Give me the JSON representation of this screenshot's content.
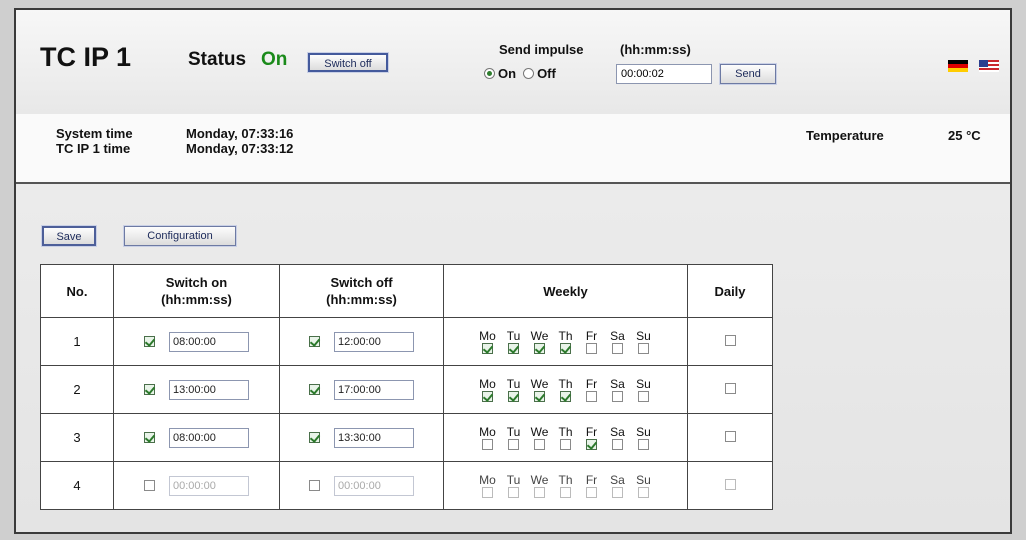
{
  "header": {
    "title": "TC IP 1",
    "status_label": "Status",
    "status_value": "On",
    "switch_off_label": "Switch off",
    "impulse_label": "Send impulse",
    "impulse_on_label": "On",
    "impulse_off_label": "Off",
    "impulse_selected": "On",
    "format_label": "(hh:mm:ss)",
    "impulse_value": "00:00:02",
    "send_label": "Send",
    "languages": [
      "de",
      "en"
    ]
  },
  "timebar": {
    "system_time_label": "System time",
    "system_time_value": "Monday, 07:33:16",
    "device_time_label": "TC IP 1 time",
    "device_time_value": "Monday, 07:33:12",
    "temperature_label": "Temperature",
    "temperature_value": "25 °C"
  },
  "toolbar": {
    "save_label": "Save",
    "config_label": "Configuration"
  },
  "table": {
    "headers": {
      "no": "No.",
      "switch_on": "Switch on",
      "switch_on_fmt": "(hh:mm:ss)",
      "switch_off": "Switch off",
      "switch_off_fmt": "(hh:mm:ss)",
      "weekly": "Weekly",
      "daily": "Daily"
    },
    "day_labels": [
      "Mo",
      "Tu",
      "We",
      "Th",
      "Fr",
      "Sa",
      "Su"
    ],
    "rows": [
      {
        "no": "1",
        "on_enabled": true,
        "on_time": "08:00:00",
        "off_enabled": true,
        "off_time": "12:00:00",
        "days": [
          true,
          true,
          true,
          true,
          false,
          false,
          false
        ],
        "daily": false,
        "disabled": false
      },
      {
        "no": "2",
        "on_enabled": true,
        "on_time": "13:00:00",
        "off_enabled": true,
        "off_time": "17:00:00",
        "days": [
          true,
          true,
          true,
          true,
          false,
          false,
          false
        ],
        "daily": false,
        "disabled": false
      },
      {
        "no": "3",
        "on_enabled": true,
        "on_time": "08:00:00",
        "off_enabled": true,
        "off_time": "13:30:00",
        "days": [
          false,
          false,
          false,
          false,
          true,
          false,
          false
        ],
        "daily": false,
        "disabled": false
      },
      {
        "no": "4",
        "on_enabled": false,
        "on_time": "00:00:00",
        "off_enabled": false,
        "off_time": "00:00:00",
        "days": [
          false,
          false,
          false,
          false,
          false,
          false,
          false
        ],
        "daily": false,
        "disabled": true
      }
    ]
  },
  "colors": {
    "status_on": "#1a8a1a",
    "border": "#444444",
    "button_border": "#6d7aa3"
  }
}
